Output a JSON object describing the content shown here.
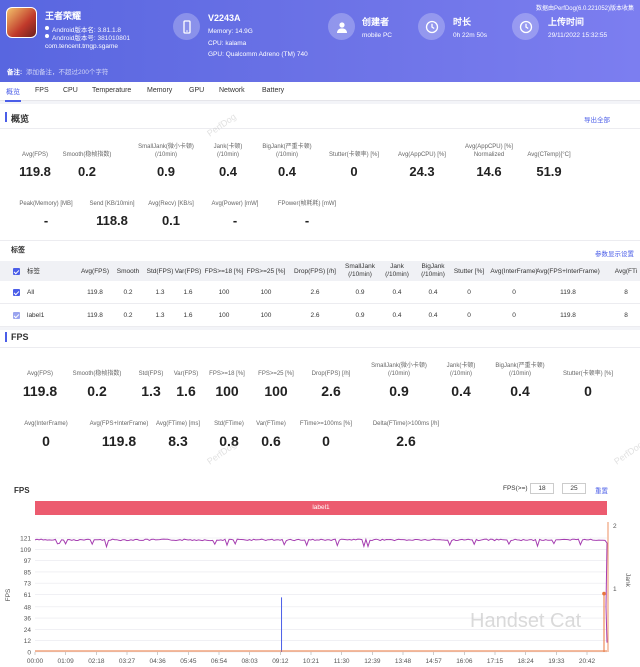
{
  "header": {
    "app_name": "王者荣耀",
    "android_version": "Android版本名: 3.81.1.8",
    "android_code": "Android版本号: 381010801",
    "package": "com.tencent.tmgp.sgame",
    "device": {
      "name": "V2243A",
      "memory": "Memory: 14.9G",
      "cpu": "CPU: kalama",
      "gpu": "GPU: Qualcomm Adreno (TM) 740"
    },
    "creator_title": "创建者",
    "creator_value": "mobile PC",
    "duration_title": "时长",
    "duration_value": "0h 22m 50s",
    "upload_title": "上传时间",
    "upload_value": "29/11/2022 15:32:55",
    "version_note": "数据由PerfDog(6.0.221052)版本收集",
    "remark_label": "备注:",
    "remark_placeholder": "添加备注，不超过200个字符"
  },
  "tabs": [
    "概览",
    "FPS",
    "CPU",
    "Temperature",
    "Memory",
    "GPU",
    "Network",
    "Battery"
  ],
  "overview": {
    "title": "概览",
    "export_label": "导出全部",
    "row1": [
      {
        "label": "Avg(FPS)",
        "value": "119.8"
      },
      {
        "label": "Smooth(稳帧指数)",
        "value": "0.2"
      },
      {
        "label": "SmallJank(微小卡顿)\n(/10min)",
        "value": "0.9"
      },
      {
        "label": "Jank(卡顿)\n(/10min)",
        "value": "0.4"
      },
      {
        "label": "BigJank(严重卡顿)\n(/10min)",
        "value": "0.4"
      },
      {
        "label": "Stutter(卡顿率) [%]",
        "value": "0"
      },
      {
        "label": "Avg(AppCPU) [%]",
        "value": "24.3"
      },
      {
        "label": "Avg(AppCPU) [%]\nNormalized",
        "value": "14.6"
      },
      {
        "label": "Avg(CTemp)[°C]",
        "value": "51.9"
      }
    ],
    "row2": [
      {
        "label": "Peak(Memory) [MB]",
        "value": "-"
      },
      {
        "label": "Send [KB/10min]",
        "value": "118.8"
      },
      {
        "label": "Avg(Recv) [KB/s]",
        "value": "0.1"
      },
      {
        "label": "Avg(Power) [mW]",
        "value": "-"
      },
      {
        "label": "FPower(帧耗耗) [mW]",
        "value": "-"
      }
    ]
  },
  "labels_table": {
    "title": "标签",
    "settings_label": "参数显示设置",
    "headers": [
      "标签",
      "Avg(FPS)",
      "Smooth",
      "Std(FPS)",
      "Var(FPS)",
      "FPS>=18 [%]",
      "FPS>=25 [%]",
      "Drop(FPS) [/h]",
      "SmallJank\n(/10min)",
      "Jank\n(/10min)",
      "BigJank\n(/10min)",
      "Stutter [%]",
      "Avg(InterFrame)",
      "Avg(FPS+InterFrame)",
      "Avg(FTi"
    ],
    "rows": [
      {
        "name": "All",
        "cells": [
          "119.8",
          "0.2",
          "1.3",
          "1.6",
          "100",
          "100",
          "2.6",
          "0.9",
          "0.4",
          "0.4",
          "0",
          "0",
          "119.8",
          "8"
        ]
      },
      {
        "name": "label1",
        "cells": [
          "119.8",
          "0.2",
          "1.3",
          "1.6",
          "100",
          "100",
          "2.6",
          "0.9",
          "0.4",
          "0.4",
          "0",
          "0",
          "119.8",
          "8"
        ]
      }
    ]
  },
  "fps_section": {
    "title": "FPS",
    "row1": [
      {
        "label": "Avg(FPS)",
        "value": "119.8"
      },
      {
        "label": "Smooth(稳帧指数)",
        "value": "0.2"
      },
      {
        "label": "Std(FPS)",
        "value": "1.3"
      },
      {
        "label": "Var(FPS)",
        "value": "1.6"
      },
      {
        "label": "FPS>=18 [%]",
        "value": "100"
      },
      {
        "label": "FPS>=25 [%]",
        "value": "100"
      },
      {
        "label": "Drop(FPS) [/h]",
        "value": "2.6"
      },
      {
        "label": "SmallJank(微小卡顿)\n(/10min)",
        "value": "0.9"
      },
      {
        "label": "Jank(卡顿)\n(/10min)",
        "value": "0.4"
      },
      {
        "label": "BigJank(严重卡顿)\n(/10min)",
        "value": "0.4"
      },
      {
        "label": "Stutter(卡顿率) [%]",
        "value": "0"
      }
    ],
    "row2": [
      {
        "label": "Avg(InterFrame)",
        "value": "0"
      },
      {
        "label": "Avg(FPS+InterFrame)",
        "value": "119.8"
      },
      {
        "label": "Avg(FTime) [ms]",
        "value": "8.3"
      },
      {
        "label": "Std(FTime)",
        "value": "0.8"
      },
      {
        "label": "Var(FTime)",
        "value": "0.6"
      },
      {
        "label": "FTime>=100ms [%]",
        "value": "0"
      },
      {
        "label": "Delta(FTime)>100ms [/h]",
        "value": "2.6"
      }
    ]
  },
  "chart_controls": {
    "title": "FPS",
    "fps_gte_label": "FPS(>=)",
    "input1": "18",
    "input2": "25",
    "reset": "重置",
    "label_bar": "label1"
  },
  "chart_data": {
    "type": "line",
    "ylabel": "FPS",
    "y2label": "Jank",
    "yticks": [
      "121",
      "109",
      "97",
      "85",
      "73",
      "61",
      "48",
      "36",
      "24",
      "12",
      "0"
    ],
    "y2ticks": [
      "2",
      "1"
    ],
    "xticks": [
      "00:00",
      "01:09",
      "02:18",
      "03:27",
      "04:36",
      "05:45",
      "06:54",
      "08:03",
      "09:12",
      "10:21",
      "11:30",
      "12:39",
      "13:48",
      "14:57",
      "16:06",
      "17:15",
      "18:24",
      "19:33",
      "20:42"
    ],
    "ylim": [
      0,
      121
    ],
    "series": [
      {
        "color": "#a53db0",
        "avg": 119.8
      },
      {
        "color": "#4b5ee8"
      },
      {
        "color": "#e8743b"
      }
    ]
  },
  "watermark": "Handset Cat",
  "perfdog_wm": "PerfDog"
}
